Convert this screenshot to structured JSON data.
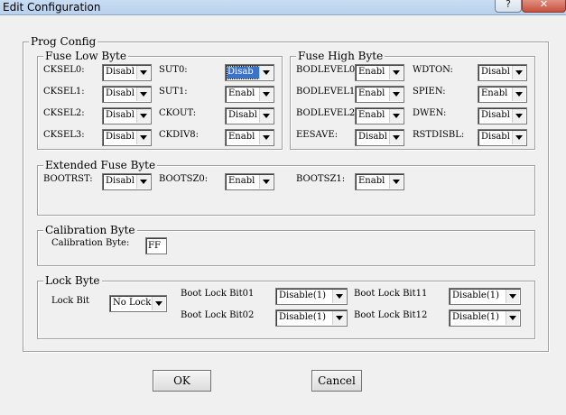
{
  "window": {
    "title": "Edit Configuration",
    "help_label": "?",
    "close_label": "✕"
  },
  "prog_config": {
    "title": "Prog Config"
  },
  "fuse_low": {
    "title": "Fuse Low Byte",
    "cksel0": {
      "label": "CKSEL0:",
      "value": "Disabl"
    },
    "cksel1": {
      "label": "CKSEL1:",
      "value": "Disabl"
    },
    "cksel2": {
      "label": "CKSEL2:",
      "value": "Disabl"
    },
    "cksel3": {
      "label": "CKSEL3:",
      "value": "Disabl"
    },
    "sut0": {
      "label": "SUT0:",
      "value": "Disab"
    },
    "sut1": {
      "label": "SUT1:",
      "value": "Enabl"
    },
    "ckout": {
      "label": "CKOUT:",
      "value": "Disabl"
    },
    "ckdiv8": {
      "label": "CKDIV8:",
      "value": "Enabl"
    }
  },
  "fuse_high": {
    "title": "Fuse High Byte",
    "bodlevel0": {
      "label": "BODLEVEL0:",
      "value": "Enabl"
    },
    "bodlevel1": {
      "label": "BODLEVEL1:",
      "value": "Enabl"
    },
    "bodlevel2": {
      "label": "BODLEVEL2:",
      "value": "Enabl"
    },
    "eesave": {
      "label": "EESAVE:",
      "value": "Disabl"
    },
    "wdton": {
      "label": "WDTON:",
      "value": "Disabl"
    },
    "spien": {
      "label": "SPIEN:",
      "value": "Enabl"
    },
    "dwen": {
      "label": "DWEN:",
      "value": "Disabl"
    },
    "rstdisbl": {
      "label": "RSTDISBL:",
      "value": "Disabl"
    }
  },
  "extended": {
    "title": "Extended Fuse Byte",
    "bootrst": {
      "label": "BOOTRST:",
      "value": "Disabl"
    },
    "bootsz0": {
      "label": "BOOTSZ0:",
      "value": "Enabl"
    },
    "bootsz1": {
      "label": "BOOTSZ1:",
      "value": "Enabl"
    }
  },
  "calibration": {
    "title": "Calibration Byte",
    "label": "Calibration Byte:",
    "value": "FF"
  },
  "lock": {
    "title": "Lock Byte",
    "lock_bit": {
      "label": "Lock Bit",
      "value": "No Lock"
    },
    "bootlock01": {
      "label": "Boot Lock Bit01",
      "value": "Disable(1)"
    },
    "bootlock02": {
      "label": "Boot Lock Bit02",
      "value": "Disable(1)"
    },
    "bootlock11": {
      "label": "Boot Lock Bit11",
      "value": "Disable(1)"
    },
    "bootlock12": {
      "label": "Boot Lock Bit12",
      "value": "Disable(1)"
    }
  },
  "buttons": {
    "ok": "OK",
    "cancel": "Cancel"
  }
}
